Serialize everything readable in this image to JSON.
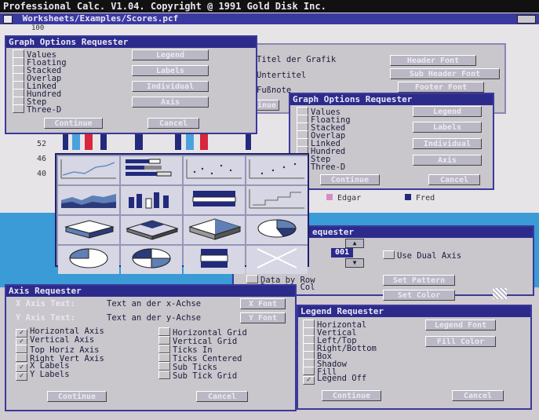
{
  "screen": {
    "title": "Professional Calc. V1.04.  Copyright @ 1991 Gold Disk Inc.",
    "doc_title": "Worksheets/Examples/Scores.pcf",
    "visible_numbers": [
      "100",
      "52",
      "46",
      "40"
    ]
  },
  "graph_options_1": {
    "title": "Graph Options Requester",
    "options": [
      "Values",
      "Floating",
      "Stacked",
      "Overlap",
      "Linked",
      "Hundred",
      "Step",
      "Three-D"
    ],
    "buttons": [
      "Legend",
      "Labels",
      "Individual",
      "Axis"
    ],
    "continue": "Continue",
    "cancel": "Cancel"
  },
  "titles_panel": {
    "rows": [
      "Titel der Grafik",
      "Untertitel",
      "Fußnote"
    ],
    "buttons": [
      "Header Font",
      "Sub Header Font",
      "Footer Font"
    ],
    "continue_partial": "inue"
  },
  "graph_options_2": {
    "title": "Graph Options Requester",
    "options": [
      "Values",
      "Floating",
      "Stacked",
      "Overlap",
      "Linked",
      "Hundred",
      "Step",
      "Three-D"
    ],
    "buttons": [
      "Legend",
      "Labels",
      "Individual",
      "Axis"
    ],
    "continue": "Continue",
    "cancel": "Cancel"
  },
  "legend_names": [
    "Edgar",
    "Fred"
  ],
  "data_requester": {
    "title_partial": "equester",
    "prefix": "r",
    "value": "001",
    "dual_axis": "Use Dual Axis",
    "data_by": [
      "Data by Row",
      "Data by Col"
    ],
    "data_by_checked": "Data by Col",
    "pattern_btn": "Set Pattern",
    "color_btn": "Set Color"
  },
  "axis_requester": {
    "title": "Axis Requester",
    "x_label": "X Axis Text:",
    "x_value": "Text an der x-Achse",
    "x_font": "X Font",
    "y_label": "Y Axis Text:",
    "y_value": "Text an der y-Achse",
    "y_font": "Y Font",
    "left_options": [
      {
        "label": "Horizontal Axis",
        "checked": true
      },
      {
        "label": "Vertical Axis",
        "checked": true
      },
      {
        "label": "Top Horiz Axis",
        "checked": false
      },
      {
        "label": "Right Vert Axis",
        "checked": false
      },
      {
        "label": "X Labels",
        "checked": true
      },
      {
        "label": "Y Labels",
        "checked": true
      }
    ],
    "right_options": [
      {
        "label": "Horizontal Grid",
        "checked": false
      },
      {
        "label": "Vertical Grid",
        "checked": false
      },
      {
        "label": "Ticks In",
        "checked": false
      },
      {
        "label": "Ticks Centered",
        "checked": false
      },
      {
        "label": "Sub Ticks",
        "checked": false
      },
      {
        "label": "Sub Tick Grid",
        "checked": false
      }
    ],
    "continue": "Continue",
    "cancel": "Cancel"
  },
  "legend_requester": {
    "title": "Legend Requester",
    "options": [
      {
        "label": "Horizontal",
        "checked": false
      },
      {
        "label": "Vertical",
        "checked": false
      },
      {
        "label": "Left/Top",
        "checked": false
      },
      {
        "label": "Right/Bottom",
        "checked": false
      },
      {
        "label": "Box",
        "checked": false
      },
      {
        "label": "Shadow",
        "checked": false
      },
      {
        "label": "Fill",
        "checked": false
      },
      {
        "label": "Legend Off",
        "checked": true
      }
    ],
    "legend_font": "Legend Font",
    "fill_color": "Fill Color",
    "continue": "Continue",
    "cancel": "Cancel"
  },
  "chart_types": [
    "line-chart-icon",
    "stacked-bar-icon",
    "scatter-icon",
    "scatter-line-icon",
    "area-chart-icon",
    "bar-chart-icon",
    "stacked-horizontal-icon",
    "step-chart-icon",
    "3d-area-icon",
    "3d-stacked-icon",
    "3d-pie-icon",
    "pie-chart-icon",
    "pie-slice-icon",
    "pie-split-icon",
    "pie-quarter-icon",
    "hundred-bar-icon"
  ],
  "colors": {
    "title_bar": "#2c2b8c",
    "window_bg": "#c9c6cc",
    "desktop_blue": "#3a9bd6",
    "button_text": "#ece9f2"
  }
}
